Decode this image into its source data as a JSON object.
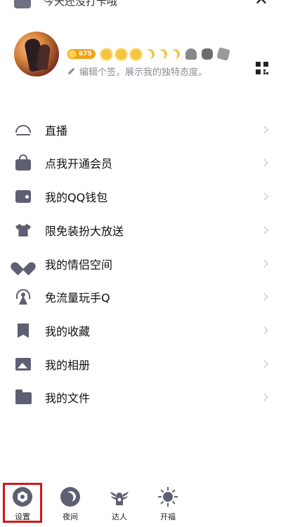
{
  "top": {
    "partial_text": "今天还没打卡哦"
  },
  "profile": {
    "level_number": "675",
    "signature": "编辑个签，展示我的独特态度。"
  },
  "menu": {
    "items": [
      {
        "label": "直播",
        "icon": "live-icon"
      },
      {
        "label": "点我开通会员",
        "icon": "vip-bag-icon"
      },
      {
        "label": "我的QQ钱包",
        "icon": "wallet-icon"
      },
      {
        "label": "限免装扮大放送",
        "icon": "shirt-icon"
      },
      {
        "label": "我的情侣空间",
        "icon": "heart-icon"
      },
      {
        "label": "免流量玩手Q",
        "icon": "antenna-icon"
      },
      {
        "label": "我的收藏",
        "icon": "bookmark-icon"
      },
      {
        "label": "我的相册",
        "icon": "photo-icon"
      },
      {
        "label": "我的文件",
        "icon": "folder-icon"
      }
    ]
  },
  "bottom": {
    "settings": "设置",
    "night": "夜间",
    "talent": "达人",
    "blessing": "开福"
  },
  "colors": {
    "icon_gray": "#5f5f73",
    "highlight_red": "#d1181b",
    "level_orange": "#f3a21b"
  }
}
